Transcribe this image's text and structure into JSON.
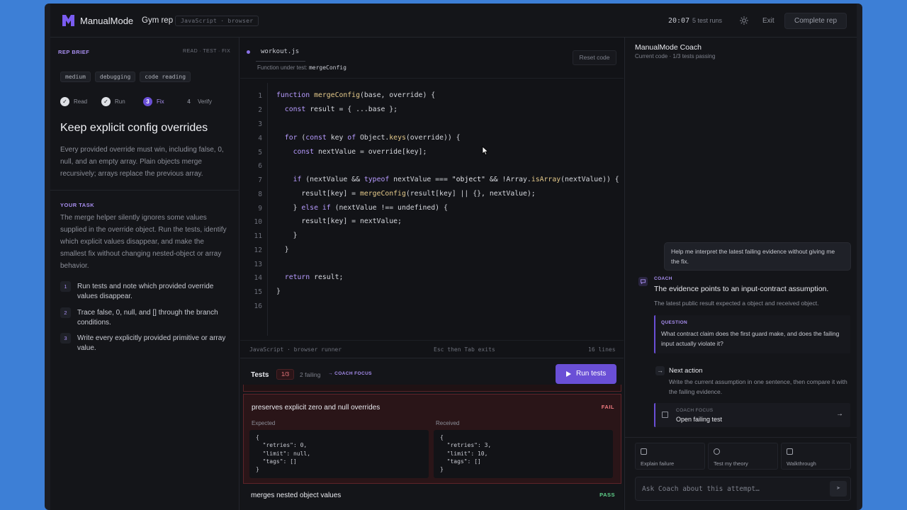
{
  "topbar": {
    "brand": "ManualMode",
    "mode": "Gym rep",
    "lang_pill": "JavaScript · browser",
    "timer": "20:07",
    "runs": "5 test runs",
    "exit": "Exit",
    "complete": "Complete rep"
  },
  "brief": {
    "title": "REP BRIEF",
    "phases": "READ · TEST · FIX",
    "tags": [
      "medium",
      "debugging",
      "code reading"
    ],
    "steps": [
      {
        "label": "Read",
        "marker": "✓"
      },
      {
        "label": "Run",
        "marker": "✓"
      },
      {
        "label": "Fix",
        "marker": "3"
      },
      {
        "label": "Verify",
        "marker": "4"
      }
    ],
    "heading": "Keep explicit config overrides",
    "description": "Every provided override must win, including false, 0, null, and an empty array. Plain objects merge recursively; arrays replace the previous array.",
    "task_title": "YOUR TASK",
    "task_description": "The merge helper silently ignores some values supplied in the override object. Run the tests, identify which explicit values disappear, and make the smallest fix without changing nested-object or array behavior.",
    "task_items": [
      {
        "num": "1",
        "text": "Run tests and note which provided override values disappear."
      },
      {
        "num": "2",
        "text": "Trace false, 0, null, and [] through the branch conditions."
      },
      {
        "num": "3",
        "text": "Write every explicitly provided primitive or array value."
      }
    ]
  },
  "editor": {
    "filename": "workout.js",
    "fn_label": "Function under test:",
    "fn_name": "mergeConfig",
    "reset": "Reset code",
    "lines": [
      "1",
      "2",
      "3",
      "4",
      "5",
      "6",
      "7",
      "8",
      "9",
      "10",
      "11",
      "12",
      "13",
      "14",
      "15",
      "16"
    ],
    "status_left": "JavaScript · browser runner",
    "status_mid": "Esc then Tab exits",
    "status_right": "16 lines"
  },
  "tests": {
    "title": "Tests",
    "count": "1/3",
    "failing": "2 failing",
    "coach_focus": "→ COACH FOCUS",
    "run_button": "Run tests",
    "fail_test": {
      "name": "preserves explicit zero and null overrides",
      "status": "FAIL",
      "expected_label": "Expected",
      "received_label": "Received",
      "expected": "{\n  \"retries\": 0,\n  \"limit\": null,\n  \"tags\": []\n}",
      "received": "{\n  \"retries\": 3,\n  \"limit\": 10,\n  \"tags\": []\n}"
    },
    "pass_test": {
      "name": "merges nested object values",
      "status": "PASS"
    }
  },
  "coach": {
    "title": "ManualMode Coach",
    "subtitle": "Current code · 1/3 tests passing",
    "user_message": "Help me interpret the latest failing evidence without giving me the fix.",
    "coach_label": "COACH",
    "coach_heading": "The evidence points to an input-contract assumption.",
    "coach_line": "The latest public result expected a object and received object.",
    "question_label": "QUESTION",
    "question_text": "What contract claim does the first guard make, and does the failing input actually violate it?",
    "next_title": "Next action",
    "next_text": "Write the current assumption in one sentence, then compare it with the failing evidence.",
    "focus_label": "COACH FOCUS",
    "focus_title": "Open failing test",
    "quick_actions": [
      "Explain failure",
      "Test my theory",
      "Walkthrough"
    ],
    "ask_placeholder": "Ask Coach about this attempt…"
  }
}
